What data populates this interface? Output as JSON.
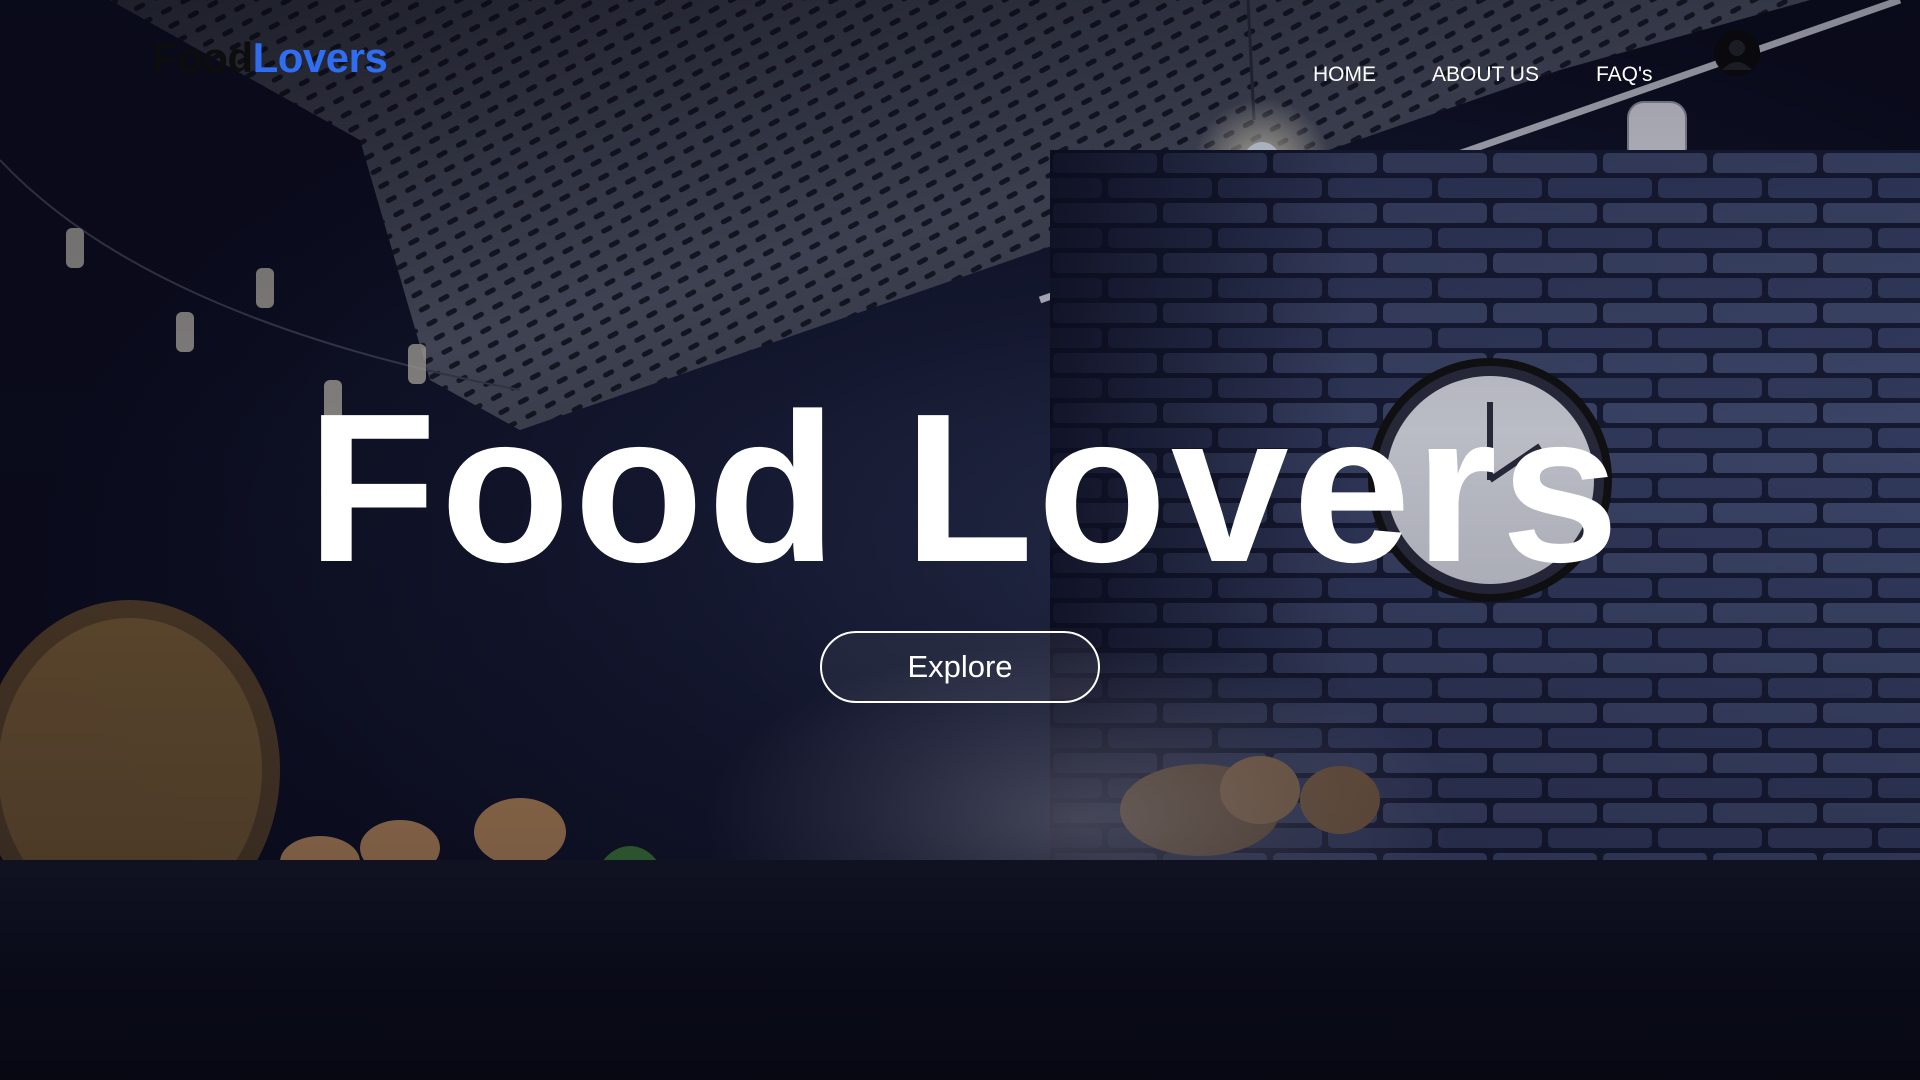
{
  "brand": {
    "logo_word_1": "Food",
    "logo_word_2": "Lovers",
    "logo_color_1": "#0d0d0d",
    "logo_color_2": "#2f6df2"
  },
  "nav": {
    "items": [
      {
        "label": "HOME"
      },
      {
        "label": "ABOUT US"
      },
      {
        "label": "FAQ's"
      }
    ],
    "avatar_icon": "user-avatar-icon"
  },
  "hero": {
    "title": "Food Lovers",
    "cta_label": "Explore"
  },
  "colors": {
    "background_dark": "#0b0c1e",
    "text": "#ffffff",
    "accent": "#2f6df2"
  }
}
